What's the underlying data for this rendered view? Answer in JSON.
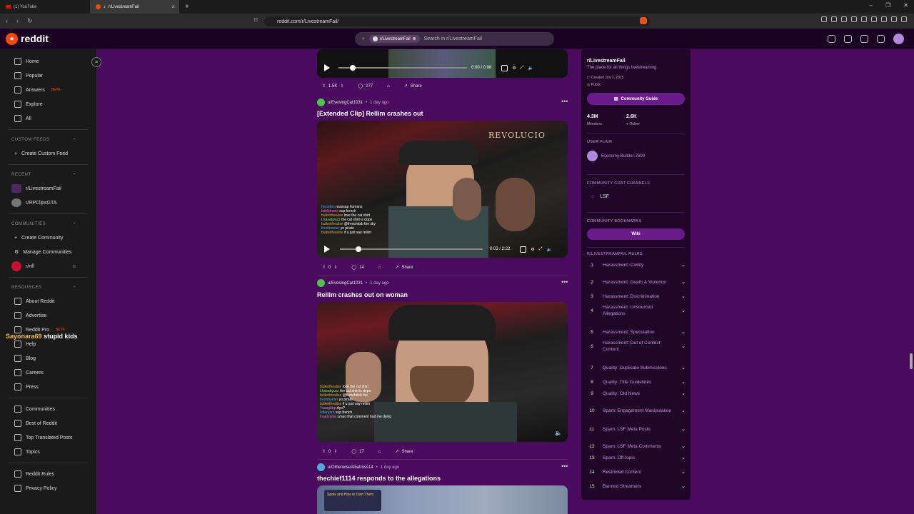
{
  "browser": {
    "tabs": [
      {
        "label": "(1) YouTube"
      },
      {
        "label": "r/LivestreamFail"
      }
    ],
    "url": "reddit.com/r/LivestreamFail/"
  },
  "header": {
    "logo": "reddit",
    "search_chip": "r/LivestreamFail",
    "search_placeholder": "Search in r/LivestreamFail"
  },
  "sidebar": {
    "main": [
      {
        "label": "Home",
        "icon": "home-icon"
      },
      {
        "label": "Popular",
        "icon": "popular-icon"
      },
      {
        "label": "Answers",
        "beta": "BETA",
        "icon": "answers-icon"
      },
      {
        "label": "Explore",
        "icon": "explore-icon"
      },
      {
        "label": "All",
        "icon": "all-icon"
      }
    ],
    "custom_feeds": {
      "title": "CUSTOM FEEDS",
      "items": [
        {
          "label": "Create Custom Feed"
        }
      ]
    },
    "recent": {
      "title": "RECENT",
      "items": [
        {
          "label": "r/LivestreamFail"
        },
        {
          "label": "r/RPClipsGTA"
        }
      ]
    },
    "communities": {
      "title": "COMMUNITIES",
      "items": [
        {
          "label": "Create Community"
        },
        {
          "label": "Manage Communities"
        },
        {
          "label": "r/nfl"
        }
      ]
    },
    "resources": {
      "title": "RESOURCES",
      "items": [
        {
          "label": "About Reddit"
        },
        {
          "label": "Advertise"
        },
        {
          "label": "Reddit Pro",
          "beta": "BETA"
        },
        {
          "label": "Help"
        },
        {
          "label": "Blog"
        },
        {
          "label": "Careers"
        },
        {
          "label": "Press"
        }
      ]
    },
    "more": [
      {
        "label": "Communities"
      },
      {
        "label": "Best of Reddit"
      },
      {
        "label": "Top Translated Posts"
      },
      {
        "label": "Topics"
      }
    ],
    "legal": [
      {
        "label": "Reddit Rules"
      },
      {
        "label": "Privacy Policy"
      }
    ],
    "overlay": {
      "user": "Sayonara69",
      "text": "stupid kids"
    }
  },
  "posts": [
    {
      "time": "0:00 / 0:08",
      "votes": "1.5K",
      "comments": "277",
      "share": "Share"
    },
    {
      "user": "u/EvesingCat1031",
      "age": "1 day ago",
      "title": "[Extended Clip] Rellim crashes out",
      "time": "0:03 / 2:22",
      "votes": "0",
      "comments": "14",
      "share": "Share",
      "sign": "REVOLUCIO",
      "chat": [
        {
          "name": "hyxxtttou",
          "msg": "wassap humans"
        },
        {
          "name": "bdsljdrastx",
          "msg": "sup french"
        },
        {
          "name": "bulkeithealise",
          "msg": "love the cat shirt"
        },
        {
          "name": "Lhasabyuzz",
          "msg": "the cat shirt is dope"
        },
        {
          "name": "bulkeithealise",
          "msg": "@frenchdsb the sky"
        },
        {
          "name": "freshbanter",
          "msg": "yo pirate"
        },
        {
          "name": "bulkeithealise",
          "msg": "if u just say rellim"
        }
      ]
    },
    {
      "user": "u/EvesingCat1031",
      "age": "1 day ago",
      "title": "Rellim crashes out on woman",
      "votes": "0",
      "comments": "17",
      "share": "Share",
      "chat": [
        {
          "name": "bulkeithealise",
          "msg": "love the cat shirt"
        },
        {
          "name": "Lhasabyuzz",
          "msg": "the cat shirt is dope"
        },
        {
          "name": "bulkeithealise",
          "msg": "@frenchdsb the"
        },
        {
          "name": "freshbanter",
          "msg": "yo pirate"
        },
        {
          "name": "bulkeithealise",
          "msg": "if u just say rellim"
        },
        {
          "name": "Yaaagbbp",
          "msg": "Ayo?"
        },
        {
          "name": "kitteryarn",
          "msg": "sup french"
        },
        {
          "name": "lnnabushe",
          "msg": "Lmao that comment had me dying"
        }
      ]
    },
    {
      "user": "u/OtherwiseAlbatross14",
      "age": "1 day ago",
      "title": "thechief1114 responds to the allegations",
      "thumb_caption": "Spots and How to Own Them"
    }
  ],
  "right": {
    "name": "r/LivestreamFail",
    "tagline": "The place for all things livestreaming.",
    "created": "Created Jun 7, 2015",
    "visibility": "Public",
    "guide": "Community Guide",
    "members": "4.3M",
    "members_label": "Members",
    "online": "2.6K",
    "online_label": "Online",
    "user_flair_title": "USER FLAIR",
    "user_flair": "Economy-Builder-7600",
    "chat_title": "COMMUNITY CHAT CHANNELS",
    "chat_channel": "LSF",
    "bookmarks_title": "COMMUNITY BOOKMARKS",
    "wiki": "Wiki",
    "rules_title": "R/LIVESTREAMFAIL RULES",
    "rules": [
      {
        "n": "1",
        "t": "Harassment: Civility"
      },
      {
        "n": "2",
        "t": "Harassment: Death & Violence"
      },
      {
        "n": "3",
        "t": "Harassment: Discrimination"
      },
      {
        "n": "4",
        "t": "Harassment: Unsourced Allegations"
      },
      {
        "n": "5",
        "t": "Harassment: Speculation"
      },
      {
        "n": "6",
        "t": "Harassment: Out of Context Content"
      },
      {
        "n": "7",
        "t": "Quality: Duplicate Submissions"
      },
      {
        "n": "8",
        "t": "Quality: Title Guidelines"
      },
      {
        "n": "9",
        "t": "Quality: Old News"
      },
      {
        "n": "10",
        "t": "Spam: Engagement Manipulation"
      },
      {
        "n": "11",
        "t": "Spam: LSF Meta Posts"
      },
      {
        "n": "12",
        "t": "Spam: LSF Meta Comments"
      },
      {
        "n": "13",
        "t": "Spam: Off-topic"
      },
      {
        "n": "14",
        "t": "Restricted Content"
      },
      {
        "n": "15",
        "t": "Banned Streamers"
      }
    ]
  }
}
